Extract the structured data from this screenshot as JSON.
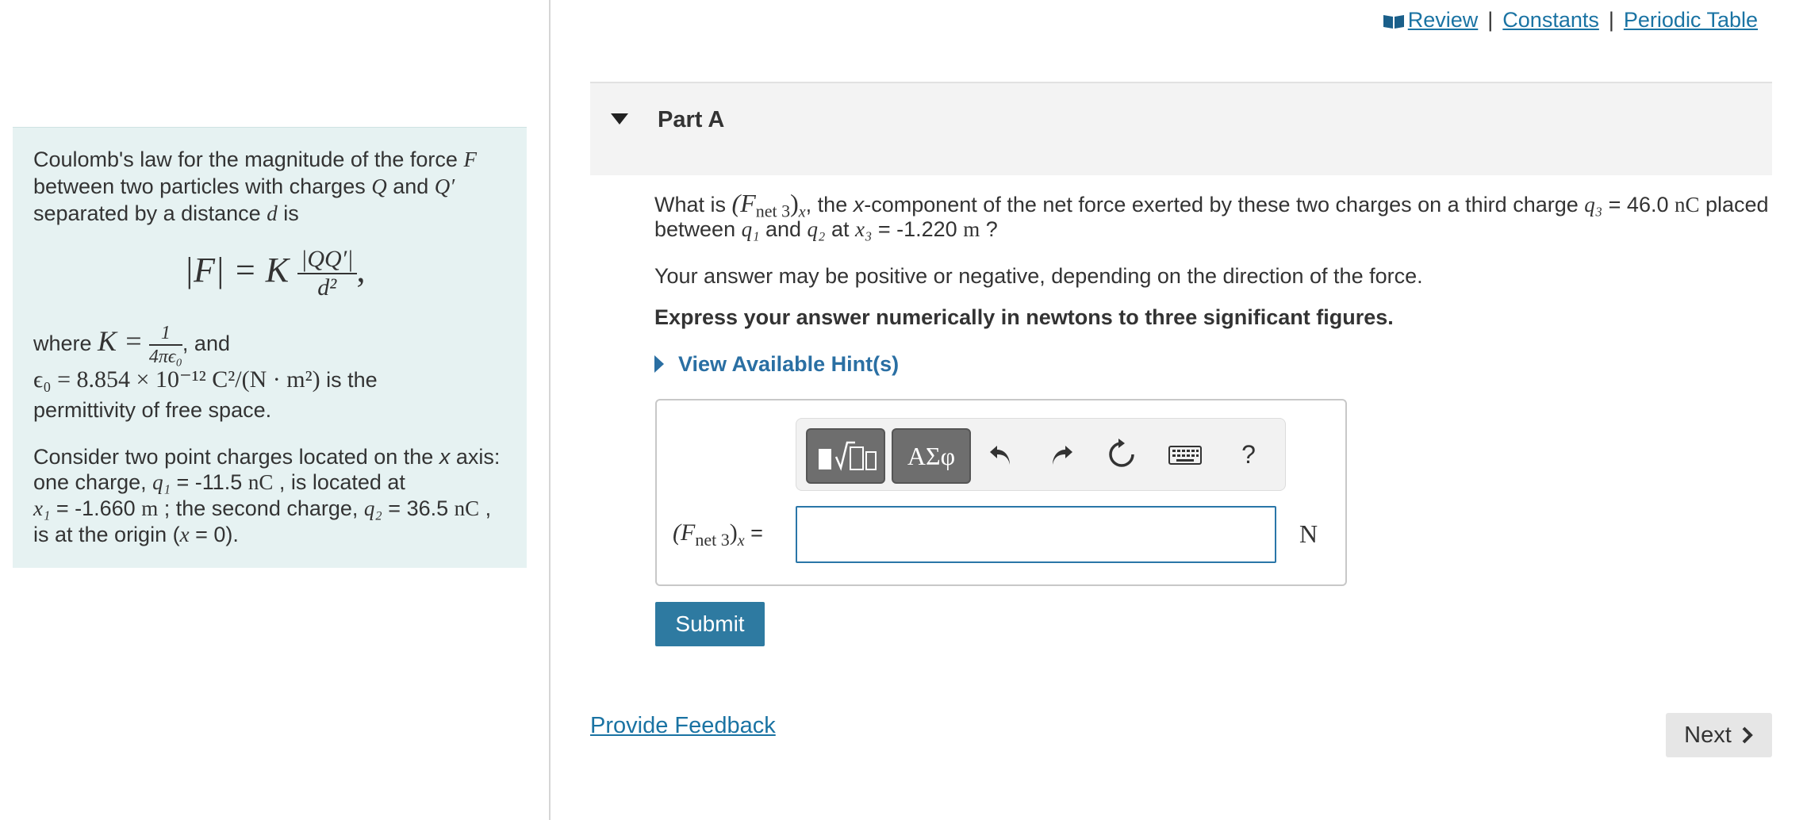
{
  "top_links": {
    "review": "Review",
    "constants": "Constants",
    "periodic_table": "Periodic Table",
    "separator": "|"
  },
  "info": {
    "line1_a": "Coulomb's law for the magnitude of the force ",
    "line1_var": "F",
    "line2_a": "between two particles with charges ",
    "line2_q": "Q",
    "line2_and": " and ",
    "line2_qp": "Q′",
    "line3_a": "separated by a distance ",
    "line3_d": "d",
    "line3_b": " is",
    "law_lhs": "|F| = K",
    "law_num": "|QQ′|",
    "law_den": "d²",
    "law_tail": ",",
    "where_a": "where ",
    "where_k": "K =",
    "k_num": "1",
    "k_den": "4πϵ₀",
    "where_b": ", and",
    "eps_expr": "ϵ₀ = 8.854 × 10⁻¹² C²/(N · m²)",
    "eps_b": " is the",
    "eps_line2": "permittivity of free space.",
    "c1": "Consider two point charges located on the ",
    "c1_x": "x",
    "c1_b": " axis:",
    "c2_a": "one charge, ",
    "c2_q1": "q₁",
    "c2_b": " = -11.5 ",
    "c2_unit": "nC",
    "c2_c": " , is located at",
    "c3_x1": "x₁",
    "c3_a": " = -1.660 ",
    "c3_unit": "m",
    "c3_b": " ; the second charge, ",
    "c3_q2": "q₂",
    "c3_c": " = 36.5 ",
    "c3_unit2": "nC",
    "c3_d": " ,",
    "c4_a": "is at the origin (",
    "c4_x": "x",
    "c4_b": " = 0)."
  },
  "part": {
    "title": "Part A"
  },
  "question": {
    "q1_a": "What is ",
    "q1_expr": "(F",
    "q1_sub": "net 3",
    "q1_close": ")",
    "q1_subx": "x",
    "q1_b": ", the ",
    "q1_x": "x",
    "q1_c": "-component of the net force exerted by these two charges on a third charge ",
    "q1_q3": "q₃",
    "q1_d": " = 46.0 ",
    "q1_unit": "nC",
    "q1_e": " placed",
    "q2_a": "between ",
    "q2_q1": "q₁",
    "q2_b": " and ",
    "q2_q2": "q₂",
    "q2_c": " at ",
    "q2_x3": "x₃",
    "q2_d": " = -1.220 ",
    "q2_unit": "m",
    "q2_e": " ?",
    "sign_note": "Your answer may be positive or negative, depending on the direction of the force.",
    "instruction": "Express your answer numerically in newtons to three significant figures."
  },
  "hint_label": "View Available Hint(s)",
  "toolbar": {
    "greek_label": "ΑΣφ",
    "help_label": "?"
  },
  "answer": {
    "label_open": "(F",
    "label_sub": "net 3",
    "label_close": ")",
    "label_subx": "x",
    "label_eq": " =",
    "value": "",
    "unit": "N"
  },
  "submit_label": "Submit",
  "feedback_label": "Provide Feedback",
  "next_label": "Next",
  "colors": {
    "accent": "#2e7aa1",
    "link": "#1a73a3",
    "info_bg": "#e6f2f2"
  }
}
